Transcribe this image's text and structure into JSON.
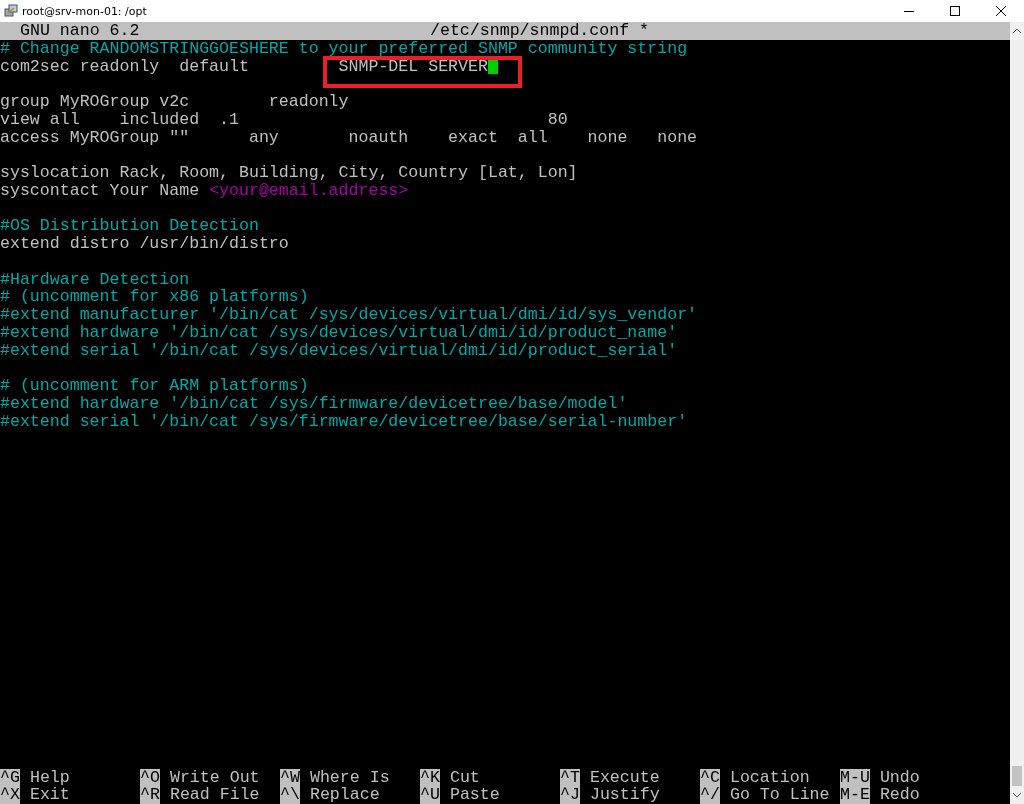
{
  "window": {
    "title": "root@srv-mon-01: /opt"
  },
  "editor": {
    "name": "GNU nano 6.2",
    "file": "/etc/snmp/snmpd.conf *"
  },
  "lines": [
    {
      "gap_before": false,
      "segments": [
        {
          "text": "# Change RANDOMSTRINGGOESHERE to your preferred SNMP community string",
          "kind": "comment"
        }
      ]
    },
    {
      "gap_before": false,
      "segments": [
        {
          "text": "com2sec readonly  default         ",
          "kind": "plain"
        },
        {
          "text": "SNMP-DEL SERVER",
          "kind": "plain",
          "highlighted": true,
          "cursor": true
        }
      ]
    },
    {
      "gap_before": true,
      "segments": [
        {
          "text": "group MyROGroup v2c        readonly",
          "kind": "plain"
        }
      ]
    },
    {
      "gap_before": false,
      "segments": [
        {
          "text": "view all    included  .1                               80",
          "kind": "plain"
        }
      ]
    },
    {
      "gap_before": false,
      "segments": [
        {
          "text": "access MyROGroup \"\"      any       noauth    exact  all    none   none",
          "kind": "plain"
        }
      ]
    },
    {
      "gap_before": true,
      "segments": [
        {
          "text": "syslocation Rack, Room, Building, City, Country [Lat, Lon]",
          "kind": "plain"
        }
      ]
    },
    {
      "gap_before": false,
      "segments": [
        {
          "text": "syscontact Your Name ",
          "kind": "plain"
        },
        {
          "text": "<your@email.address>",
          "kind": "email"
        }
      ]
    },
    {
      "gap_before": true,
      "segments": [
        {
          "text": "#OS Distribution Detection",
          "kind": "comment"
        }
      ]
    },
    {
      "gap_before": false,
      "segments": [
        {
          "text": "extend distro /usr/bin/distro",
          "kind": "plain"
        }
      ]
    },
    {
      "gap_before": true,
      "segments": [
        {
          "text": "#Hardware Detection",
          "kind": "comment"
        }
      ]
    },
    {
      "gap_before": false,
      "segments": [
        {
          "text": "# (uncomment for x86 platforms)",
          "kind": "comment"
        }
      ]
    },
    {
      "gap_before": false,
      "segments": [
        {
          "text": "#extend manufacturer '/bin/cat /sys/devices/virtual/dmi/id/sys_vendor'",
          "kind": "comment"
        }
      ]
    },
    {
      "gap_before": false,
      "segments": [
        {
          "text": "#extend hardware '/bin/cat /sys/devices/virtual/dmi/id/product_name'",
          "kind": "comment"
        }
      ]
    },
    {
      "gap_before": false,
      "segments": [
        {
          "text": "#extend serial '/bin/cat /sys/devices/virtual/dmi/id/product_serial'",
          "kind": "comment"
        }
      ]
    },
    {
      "gap_before": true,
      "segments": [
        {
          "text": "# (uncomment for ARM platforms)",
          "kind": "comment"
        }
      ]
    },
    {
      "gap_before": false,
      "segments": [
        {
          "text": "#extend hardware '/bin/cat /sys/firmware/devicetree/base/model'",
          "kind": "comment"
        }
      ]
    },
    {
      "gap_before": false,
      "segments": [
        {
          "text": "#extend serial '/bin/cat /sys/firmware/devicetree/base/serial-number'",
          "kind": "comment"
        }
      ]
    }
  ],
  "shortcuts": [
    {
      "key": "^G",
      "label": "Help"
    },
    {
      "key": "^O",
      "label": "Write Out"
    },
    {
      "key": "^W",
      "label": "Where Is"
    },
    {
      "key": "^K",
      "label": "Cut"
    },
    {
      "key": "^T",
      "label": "Execute"
    },
    {
      "key": "^C",
      "label": "Location"
    },
    {
      "key": "M-U",
      "label": "Undo"
    },
    {
      "key": "^X",
      "label": "Exit"
    },
    {
      "key": "^R",
      "label": "Read File"
    },
    {
      "key": "^\\",
      "label": "Replace"
    },
    {
      "key": "^U",
      "label": "Paste"
    },
    {
      "key": "^J",
      "label": "Justify"
    },
    {
      "key": "^/",
      "label": "Go To Line"
    },
    {
      "key": "M-E",
      "label": "Redo"
    }
  ]
}
